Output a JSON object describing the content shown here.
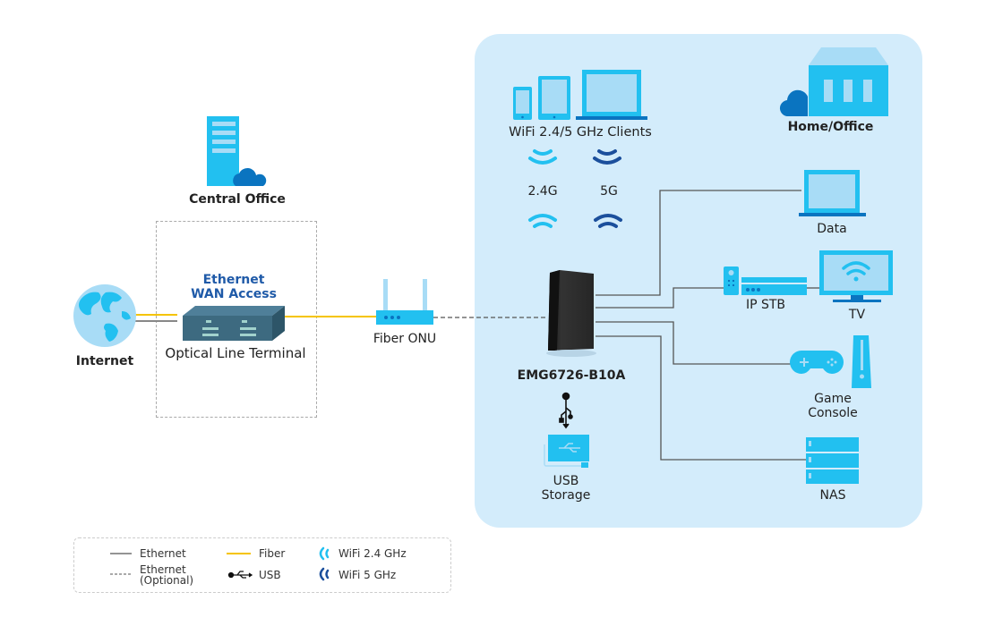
{
  "colors": {
    "panel_bg": "#d3ecfb",
    "icon_light": "#22c0f0",
    "icon_pale": "#a8dcf6",
    "icon_dark": "#0a74c0",
    "wifi_5g": "#1b4f9c",
    "fiber": "#f5c400",
    "ethernet": "#555555",
    "title_blue": "#1f5aa8"
  },
  "nodes": {
    "central_office": "Central Office",
    "internet": "Internet",
    "ethernet_wan_line1": "Ethernet",
    "ethernet_wan_line2": "WAN Access",
    "olt": "Optical Line Terminal",
    "fiber_onu": "Fiber ONU",
    "router": "EMG6726-B10A",
    "home_office": "Home/Office",
    "wifi_clients": "WiFi 2.4/5 GHz Clients",
    "band_24": "2.4G",
    "band_5": "5G",
    "data": "Data",
    "ip_stb": "IP STB",
    "tv": "TV",
    "game_line1": "Game",
    "game_line2": "Console",
    "nas": "NAS",
    "usb_line1": "USB",
    "usb_line2": "Storage"
  },
  "legend": {
    "ethernet": "Ethernet",
    "ethernet_optional_line1": "Ethernet",
    "ethernet_optional_line2": "(Optional)",
    "fiber": "Fiber",
    "usb": "USB",
    "wifi24": "WiFi 2.4 GHz",
    "wifi5": "WiFi 5 GHz"
  }
}
